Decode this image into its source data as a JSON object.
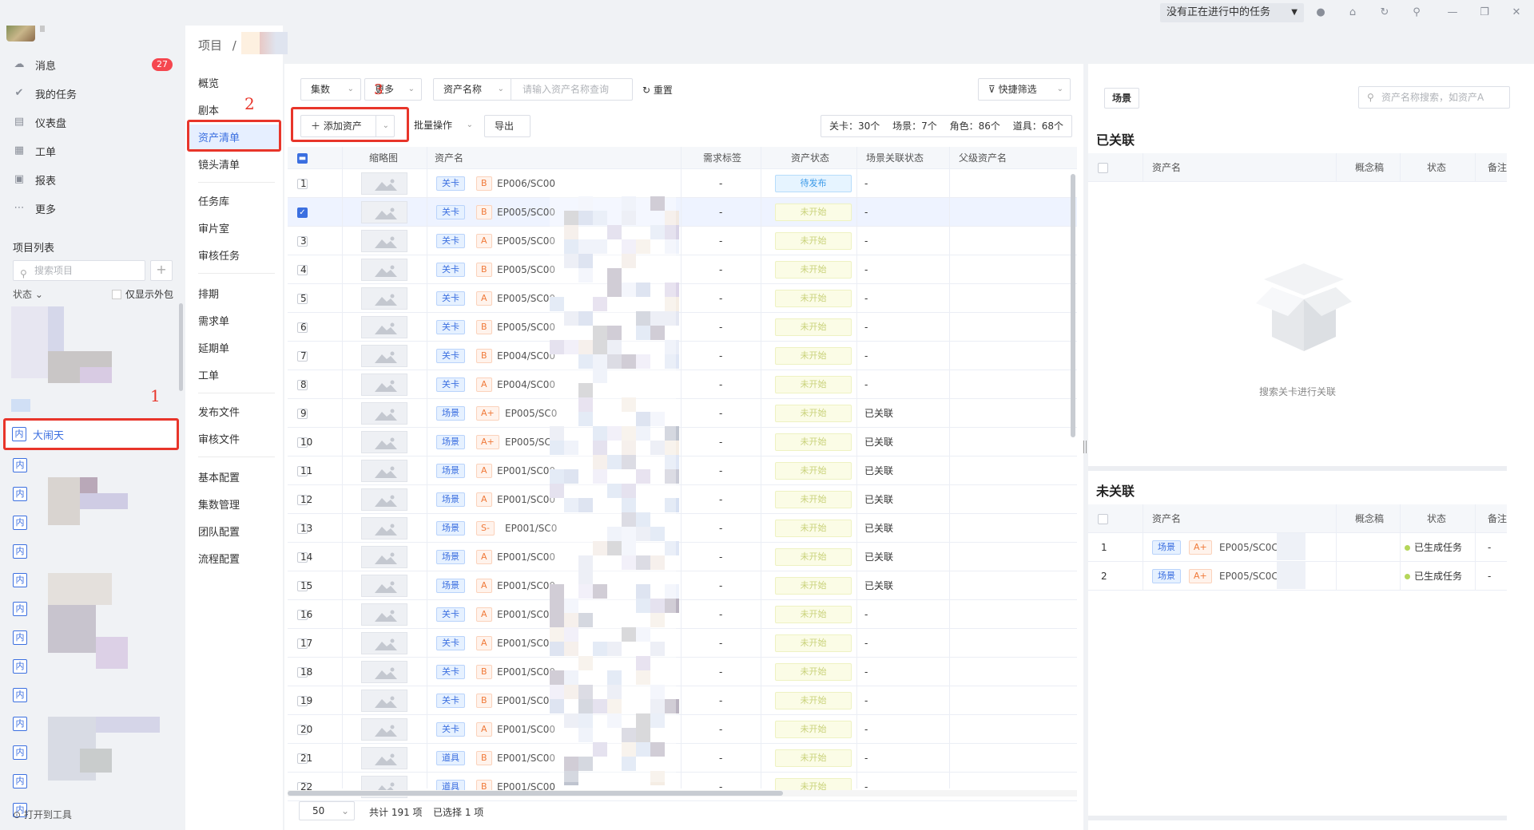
{
  "topbar": {
    "task_status": "没有正在进行中的任务"
  },
  "nav": {
    "messages": "消息",
    "messages_badge": "27",
    "my_tasks": "我的任务",
    "dashboard": "仪表盘",
    "workorders": "工单",
    "reports": "报表",
    "more": "更多"
  },
  "projects": {
    "title": "项目列表",
    "search_placeholder": "搜索项目",
    "add": "+",
    "status_filter": "状态",
    "show_outside": "仅显示外包",
    "tag": "内",
    "active_name": "大闹天",
    "items": [
      "",
      "",
      "",
      "",
      "",
      "",
      "",
      "",
      "",
      "",
      "",
      "",
      ""
    ]
  },
  "annotations": {
    "n1": "1",
    "n2": "2",
    "n3": "3"
  },
  "breadcrumb": {
    "root": "项目",
    "sep": "/"
  },
  "subnav": {
    "overview": "概览",
    "script": "剧本",
    "asset_list": "资产清单",
    "shot_list": "镜头清单",
    "task_lib": "任务库",
    "review_room": "审片室",
    "review_tasks": "审核任务",
    "schedule": "排期",
    "demands": "需求单",
    "delays": "延期单",
    "workorders": "工单",
    "publish_files": "发布文件",
    "review_files": "审核文件",
    "basic_config": "基本配置",
    "episode_mgmt": "集数管理",
    "team_config": "团队配置",
    "flow_config": "流程配置"
  },
  "filters": {
    "episodes": "集数",
    "more": "更多",
    "asset_name": "资产名称",
    "asset_placeholder": "请输入资产名称查询",
    "reset": "重置",
    "quick_filter": "快捷筛选"
  },
  "actions": {
    "add_asset": "添加资产",
    "batch": "批量操作",
    "export": "导出"
  },
  "stats": {
    "level": "关卡：30个",
    "scene": "场景：7个",
    "character": "角色：86个",
    "prop": "道具：68个"
  },
  "table": {
    "headers": {
      "thumb": "缩略图",
      "name": "资产名",
      "tags": "需求标签",
      "status": "资产状态",
      "link": "场景关联状态",
      "parent": "父级资产名"
    },
    "rows": [
      {
        "idx": "1",
        "type": "关卡",
        "grade": "B",
        "name": "EP006/SC00",
        "tag": "-",
        "status": "待发布",
        "link": "-"
      },
      {
        "idx": "",
        "type": "关卡",
        "grade": "B",
        "name": "EP005/SC00",
        "tag": "-",
        "status": "未开始",
        "link": "-"
      },
      {
        "idx": "3",
        "type": "关卡",
        "grade": "A",
        "name": "EP005/SC00",
        "tag": "-",
        "status": "未开始",
        "link": "-"
      },
      {
        "idx": "4",
        "type": "关卡",
        "grade": "B",
        "name": "EP005/SC00",
        "tag": "-",
        "status": "未开始",
        "link": "-"
      },
      {
        "idx": "5",
        "type": "关卡",
        "grade": "A",
        "name": "EP005/SC00",
        "tag": "-",
        "status": "未开始",
        "link": "-"
      },
      {
        "idx": "6",
        "type": "关卡",
        "grade": "B",
        "name": "EP005/SC00",
        "tag": "-",
        "status": "未开始",
        "link": "-"
      },
      {
        "idx": "7",
        "type": "关卡",
        "grade": "B",
        "name": "EP004/SC00",
        "tag": "-",
        "status": "未开始",
        "link": "-"
      },
      {
        "idx": "8",
        "type": "关卡",
        "grade": "A",
        "name": "EP004/SC00",
        "tag": "-",
        "status": "未开始",
        "link": "-"
      },
      {
        "idx": "9",
        "type": "场景",
        "grade": "A+",
        "name": "EP005/SC0",
        "tag": "-",
        "status": "未开始",
        "link": "已关联"
      },
      {
        "idx": "10",
        "type": "场景",
        "grade": "A+",
        "name": "EP005/SC0",
        "tag": "-",
        "status": "未开始",
        "link": "已关联"
      },
      {
        "idx": "11",
        "type": "场景",
        "grade": "A",
        "name": "EP001/SC00",
        "tag": "-",
        "status": "未开始",
        "link": "已关联"
      },
      {
        "idx": "12",
        "type": "场景",
        "grade": "A",
        "name": "EP001/SC00",
        "tag": "-",
        "status": "未开始",
        "link": "已关联"
      },
      {
        "idx": "13",
        "type": "场景",
        "grade": "S-",
        "name": "EP001/SC0",
        "tag": "-",
        "status": "未开始",
        "link": "已关联"
      },
      {
        "idx": "14",
        "type": "场景",
        "grade": "A",
        "name": "EP001/SC00",
        "tag": "-",
        "status": "未开始",
        "link": "已关联"
      },
      {
        "idx": "15",
        "type": "场景",
        "grade": "A",
        "name": "EP001/SC00",
        "tag": "-",
        "status": "未开始",
        "link": "已关联"
      },
      {
        "idx": "16",
        "type": "关卡",
        "grade": "A",
        "name": "EP001/SC00",
        "tag": "-",
        "status": "未开始",
        "link": "-"
      },
      {
        "idx": "17",
        "type": "关卡",
        "grade": "A",
        "name": "EP001/SC00",
        "tag": "-",
        "status": "未开始",
        "link": "-"
      },
      {
        "idx": "18",
        "type": "关卡",
        "grade": "B",
        "name": "EP001/SC00",
        "tag": "-",
        "status": "未开始",
        "link": "-"
      },
      {
        "idx": "19",
        "type": "关卡",
        "grade": "B",
        "name": "EP001/SC00",
        "tag": "-",
        "status": "未开始",
        "link": "-"
      },
      {
        "idx": "20",
        "type": "关卡",
        "grade": "A",
        "name": "EP001/SC00",
        "tag": "-",
        "status": "未开始",
        "link": "-"
      },
      {
        "idx": "21",
        "type": "道具",
        "grade": "B",
        "name": "EP001/SC00",
        "tag": "-",
        "status": "未开始",
        "link": "-"
      },
      {
        "idx": "22",
        "type": "道具",
        "grade": "B",
        "name": "EP001/SC00",
        "tag": "-",
        "status": "未开始",
        "link": "-"
      }
    ]
  },
  "pager": {
    "size": "50",
    "total": "共计 191 项",
    "selected": "已选择 1 项"
  },
  "right": {
    "tab": "场景",
    "search_placeholder": "资产名称搜索，如资产A",
    "linked_title": "已关联",
    "unlinked_title": "未关联",
    "headers": {
      "name": "资产名",
      "concept": "概念稿",
      "status": "状态",
      "note": "备注"
    },
    "empty_text": "搜索关卡进行关联",
    "unlinked_rows": [
      {
        "idx": "1",
        "type": "场景",
        "grade": "A+",
        "name": "EP005/SC0C",
        "status": "已生成任务",
        "note": "-"
      },
      {
        "idx": "2",
        "type": "场景",
        "grade": "A+",
        "name": "EP005/SC0C",
        "status": "已生成任务",
        "note": "-"
      }
    ]
  },
  "footer": {
    "text": "打开到工具"
  }
}
